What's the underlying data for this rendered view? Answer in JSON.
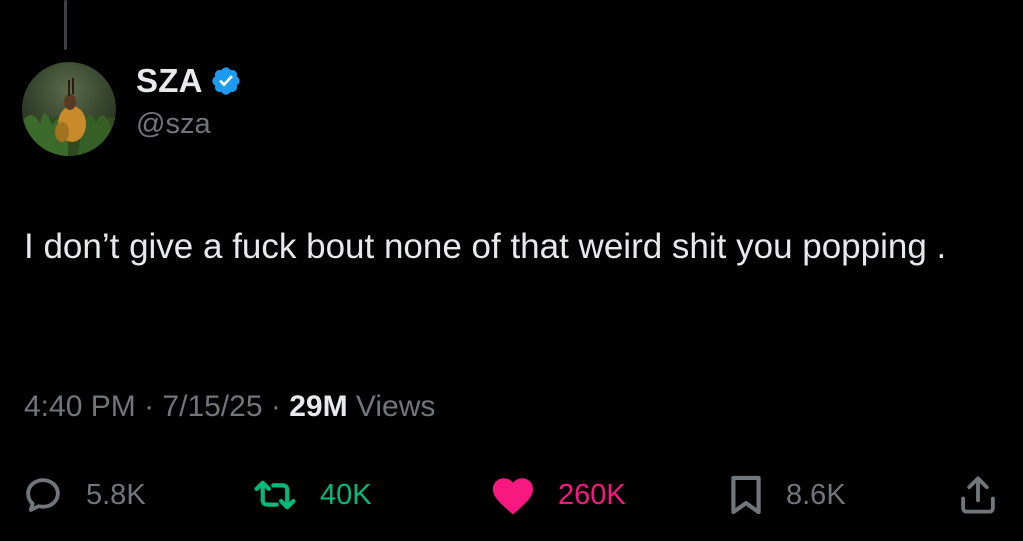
{
  "tweet": {
    "author": {
      "display_name": "SZA",
      "handle": "@sza",
      "verified": true
    },
    "text": "I don’t give a fuck bout none of that weird shit you popping .",
    "time": "4:40 PM",
    "date": "7/15/25",
    "separator": "·",
    "views_count": "29M",
    "views_label": "Views"
  },
  "actions": {
    "replies": "5.8K",
    "retweets": "40K",
    "likes": "260K",
    "bookmarks": "8.6K"
  },
  "colors": {
    "background": "#000000",
    "text": "#e7e9ea",
    "secondary": "#71767b",
    "verified": "#1d9bf0",
    "retweet_active": "#00ba7c",
    "like_active": "#f91880"
  },
  "icons": [
    "reply-icon",
    "retweet-icon",
    "heart-icon",
    "bookmark-icon",
    "share-icon",
    "verified-badge-icon"
  ]
}
